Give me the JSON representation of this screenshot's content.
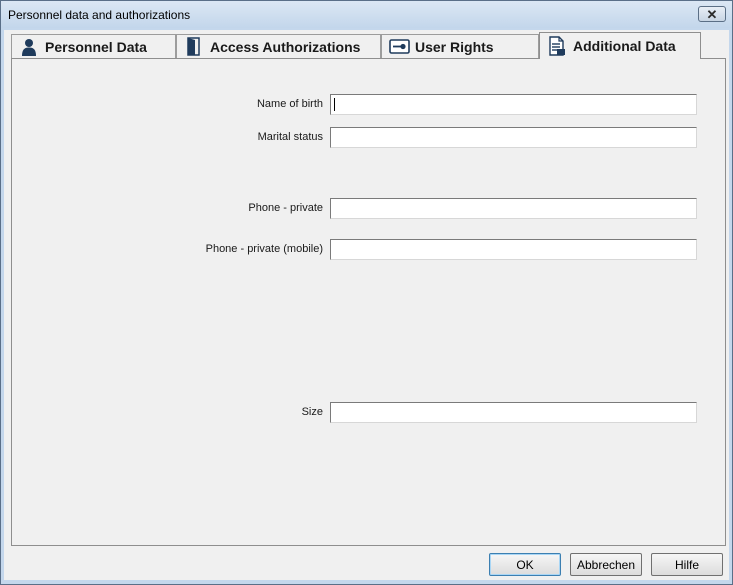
{
  "window": {
    "title": "Personnel data and authorizations",
    "close_glyph": "✕"
  },
  "tabs": [
    {
      "label": "Personnel Data",
      "icon": "person-icon",
      "active": false
    },
    {
      "label": "Access Authorizations",
      "icon": "door-icon",
      "active": false
    },
    {
      "label": "User Rights",
      "icon": "key-card-icon",
      "active": false
    },
    {
      "label": "Additional Data",
      "icon": "document-icon",
      "active": true
    }
  ],
  "fields": {
    "name_of_birth": {
      "label": "Name of birth",
      "value": ""
    },
    "marital_status": {
      "label": "Marital status",
      "value": ""
    },
    "phone_private": {
      "label": "Phone - private",
      "value": ""
    },
    "phone_mobile": {
      "label": "Phone - private (mobile)",
      "value": ""
    },
    "size": {
      "label": "Size",
      "value": ""
    }
  },
  "buttons": {
    "ok": "OK",
    "cancel": "Abbrechen",
    "help": "Hilfe"
  },
  "colors": {
    "icon_blue": "#1f3b5c",
    "titlebar": "#c4d7ec"
  }
}
